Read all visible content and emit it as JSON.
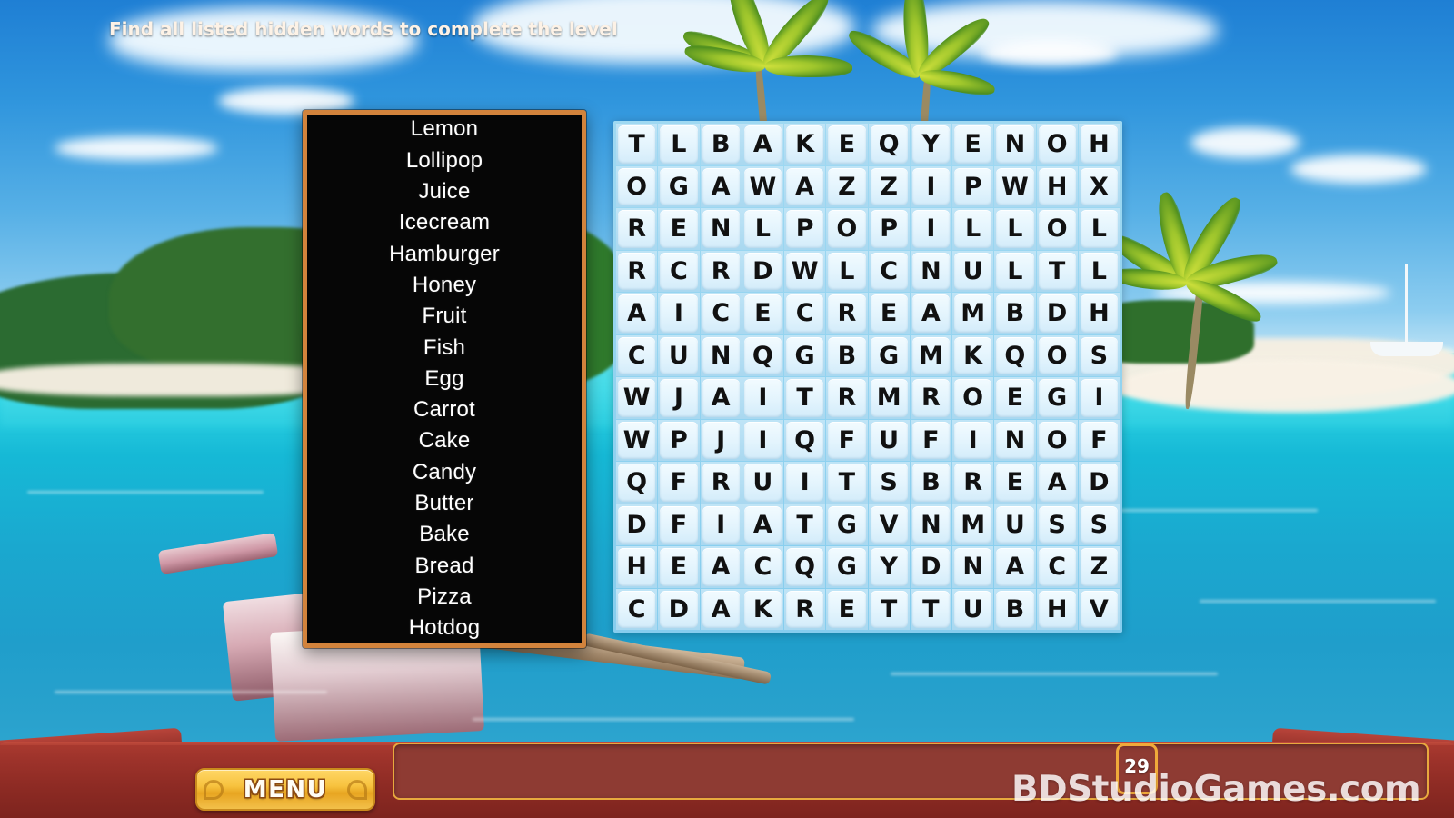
{
  "game": {
    "title": "Word Search",
    "background_scene": "tropical-beach"
  },
  "word_list": {
    "panel_border_color": "#d2833c",
    "panel_background_color": "#060606",
    "text_color": "#ffffff",
    "words": [
      "Lemon",
      "Lollipop",
      "Juice",
      "Icecream",
      "Hamburger",
      "Honey",
      "Fruit",
      "Fish",
      "Egg",
      "Carrot",
      "Cake",
      "Candy",
      "Butter",
      "Bake",
      "Bread",
      "Pizza",
      "Hotdog"
    ]
  },
  "grid": {
    "rows": 12,
    "cols": 12,
    "tile_color": "#e3f4fd",
    "letter_color": "#111111",
    "board_color": "#9fd9f2",
    "letters": [
      [
        "T",
        "L",
        "B",
        "A",
        "K",
        "E",
        "Q",
        "Y",
        "E",
        "N",
        "O",
        "H"
      ],
      [
        "O",
        "G",
        "A",
        "W",
        "A",
        "Z",
        "Z",
        "I",
        "P",
        "W",
        "H",
        "X"
      ],
      [
        "R",
        "E",
        "N",
        "L",
        "P",
        "O",
        "P",
        "I",
        "L",
        "L",
        "O",
        "L"
      ],
      [
        "R",
        "C",
        "R",
        "D",
        "W",
        "L",
        "C",
        "N",
        "U",
        "L",
        "T",
        "L"
      ],
      [
        "A",
        "I",
        "C",
        "E",
        "C",
        "R",
        "E",
        "A",
        "M",
        "B",
        "D",
        "H"
      ],
      [
        "C",
        "U",
        "N",
        "Q",
        "G",
        "B",
        "G",
        "M",
        "K",
        "Q",
        "O",
        "S"
      ],
      [
        "W",
        "J",
        "A",
        "I",
        "T",
        "R",
        "M",
        "R",
        "O",
        "E",
        "G",
        "I"
      ],
      [
        "W",
        "P",
        "J",
        "I",
        "Q",
        "F",
        "U",
        "F",
        "I",
        "N",
        "O",
        "F"
      ],
      [
        "Q",
        "F",
        "R",
        "U",
        "I",
        "T",
        "S",
        "B",
        "R",
        "E",
        "A",
        "D"
      ],
      [
        "D",
        "F",
        "I",
        "A",
        "T",
        "G",
        "V",
        "N",
        "M",
        "U",
        "S",
        "S"
      ],
      [
        "H",
        "E",
        "A",
        "C",
        "Q",
        "G",
        "Y",
        "D",
        "N",
        "A",
        "C",
        "Z"
      ],
      [
        "C",
        "D",
        "A",
        "K",
        "R",
        "E",
        "T",
        "T",
        "U",
        "B",
        "H",
        "V"
      ]
    ]
  },
  "bottom_bar": {
    "menu_label": "MENU",
    "hint_text": "Find all listed hidden words to complete the level",
    "counter_value": "29",
    "watermark": "BDStudioGames.com",
    "bar_color": "#8e3b33",
    "accent_color": "#e8a93e",
    "menu_button_color": "#f7c23e"
  }
}
